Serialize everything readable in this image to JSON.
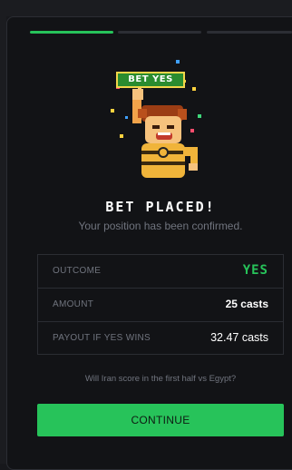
{
  "progress": {
    "total_steps": 3,
    "current_step": 1
  },
  "illustration": {
    "badge_label": "BET YES",
    "description_icon": "celebrating-mascot-icon"
  },
  "confirmation": {
    "title": "BET PLACED!",
    "subtitle": "Your position has been confirmed."
  },
  "details": {
    "outcome_label": "OUTCOME",
    "outcome_value": "YES",
    "amount_label": "AMOUNT",
    "amount_value": "25 casts",
    "payout_label": "PAYOUT IF YES WINS",
    "payout_value": "32.47 casts"
  },
  "question": "Will Iran score in the first half vs Egypt?",
  "continue_label": "CONTINUE",
  "colors": {
    "accent_green": "#27c35a",
    "panel_bg": "#121316",
    "muted_text": "#70747e"
  }
}
